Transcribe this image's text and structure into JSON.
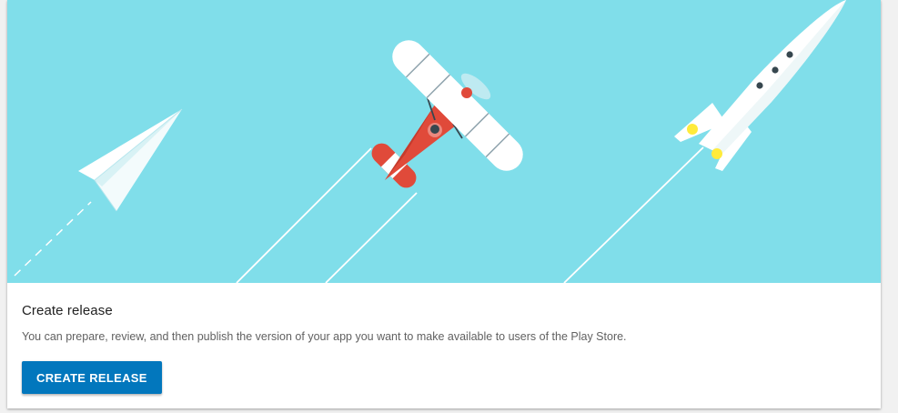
{
  "card": {
    "title": "Create release",
    "description": "You can prepare, review, and then publish the version of your app you want to make available to users of the Play Store.",
    "button_label": "CREATE RELEASE"
  },
  "colors": {
    "hero_background": "#80deea",
    "primary_button": "#0277bd",
    "plane_red": "#e04a3a",
    "rocket_window": "#37474f",
    "rocket_flame": "#ffeb3b"
  },
  "illustration": {
    "items": [
      "paper-plane-icon",
      "biplane-icon",
      "rocket-icon"
    ]
  }
}
